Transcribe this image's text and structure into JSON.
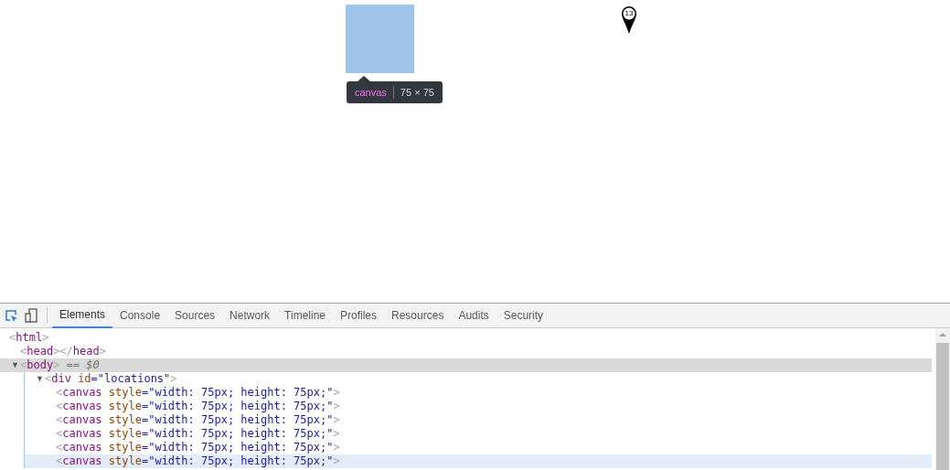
{
  "page": {
    "marker_label": "13",
    "tooltip": {
      "tag": "canvas",
      "size": "75 × 75"
    }
  },
  "devtools": {
    "tabs": [
      {
        "label": "Elements",
        "selected": true
      },
      {
        "label": "Console",
        "selected": false
      },
      {
        "label": "Sources",
        "selected": false
      },
      {
        "label": "Network",
        "selected": false
      },
      {
        "label": "Timeline",
        "selected": false
      },
      {
        "label": "Profiles",
        "selected": false
      },
      {
        "label": "Resources",
        "selected": false
      },
      {
        "label": "Audits",
        "selected": false
      },
      {
        "label": "Security",
        "selected": false
      }
    ],
    "dom_tree": [
      {
        "selected": false,
        "hovered": false,
        "parts": [
          {
            "kind": "punct",
            "text": "<"
          },
          {
            "kind": "tag",
            "text": "html"
          },
          {
            "kind": "punct",
            "text": ">"
          }
        ],
        "children": [
          {
            "selected": false,
            "hovered": false,
            "parts": [
              {
                "kind": "punct",
                "text": "<"
              },
              {
                "kind": "tag",
                "text": "head"
              },
              {
                "kind": "punct",
                "text": "></"
              },
              {
                "kind": "tag",
                "text": "head"
              },
              {
                "kind": "punct",
                "text": ">"
              }
            ]
          },
          {
            "arrow": "▼",
            "selected": true,
            "hovered": false,
            "parts": [
              {
                "kind": "punct",
                "text": "<"
              },
              {
                "kind": "tag",
                "text": "body"
              },
              {
                "kind": "punct",
                "text": ">"
              },
              {
                "kind": "note",
                "text": " == $0"
              }
            ],
            "children": [
              {
                "arrow": "▼",
                "selected": false,
                "hovered": false,
                "parts": [
                  {
                    "kind": "punct",
                    "text": "<"
                  },
                  {
                    "kind": "tag",
                    "text": "div"
                  },
                  {
                    "kind": "attr",
                    "text": " id"
                  },
                  {
                    "kind": "plain",
                    "text": "=\""
                  },
                  {
                    "kind": "value",
                    "text": "locations"
                  },
                  {
                    "kind": "plain",
                    "text": "\""
                  },
                  {
                    "kind": "punct",
                    "text": ">"
                  }
                ],
                "children": [
                  {
                    "selected": false,
                    "hovered": false,
                    "parts": [
                      {
                        "kind": "punct",
                        "text": "<"
                      },
                      {
                        "kind": "tag",
                        "text": "canvas"
                      },
                      {
                        "kind": "attr",
                        "text": " style"
                      },
                      {
                        "kind": "plain",
                        "text": "=\""
                      },
                      {
                        "kind": "value",
                        "text": "width: 75px; height: 75px;"
                      },
                      {
                        "kind": "plain",
                        "text": "\""
                      },
                      {
                        "kind": "punct",
                        "text": ">"
                      }
                    ]
                  },
                  {
                    "selected": false,
                    "hovered": false,
                    "parts": [
                      {
                        "kind": "punct",
                        "text": "<"
                      },
                      {
                        "kind": "tag",
                        "text": "canvas"
                      },
                      {
                        "kind": "attr",
                        "text": " style"
                      },
                      {
                        "kind": "plain",
                        "text": "=\""
                      },
                      {
                        "kind": "value",
                        "text": "width: 75px; height: 75px;"
                      },
                      {
                        "kind": "plain",
                        "text": "\""
                      },
                      {
                        "kind": "punct",
                        "text": ">"
                      }
                    ]
                  },
                  {
                    "selected": false,
                    "hovered": false,
                    "parts": [
                      {
                        "kind": "punct",
                        "text": "<"
                      },
                      {
                        "kind": "tag",
                        "text": "canvas"
                      },
                      {
                        "kind": "attr",
                        "text": " style"
                      },
                      {
                        "kind": "plain",
                        "text": "=\""
                      },
                      {
                        "kind": "value",
                        "text": "width: 75px; height: 75px;"
                      },
                      {
                        "kind": "plain",
                        "text": "\""
                      },
                      {
                        "kind": "punct",
                        "text": ">"
                      }
                    ]
                  },
                  {
                    "selected": false,
                    "hovered": false,
                    "parts": [
                      {
                        "kind": "punct",
                        "text": "<"
                      },
                      {
                        "kind": "tag",
                        "text": "canvas"
                      },
                      {
                        "kind": "attr",
                        "text": " style"
                      },
                      {
                        "kind": "plain",
                        "text": "=\""
                      },
                      {
                        "kind": "value",
                        "text": "width: 75px; height: 75px;"
                      },
                      {
                        "kind": "plain",
                        "text": "\""
                      },
                      {
                        "kind": "punct",
                        "text": ">"
                      }
                    ]
                  },
                  {
                    "selected": false,
                    "hovered": false,
                    "parts": [
                      {
                        "kind": "punct",
                        "text": "<"
                      },
                      {
                        "kind": "tag",
                        "text": "canvas"
                      },
                      {
                        "kind": "attr",
                        "text": " style"
                      },
                      {
                        "kind": "plain",
                        "text": "=\""
                      },
                      {
                        "kind": "value",
                        "text": "width: 75px; height: 75px;"
                      },
                      {
                        "kind": "plain",
                        "text": "\""
                      },
                      {
                        "kind": "punct",
                        "text": ">"
                      }
                    ]
                  },
                  {
                    "selected": false,
                    "hovered": true,
                    "parts": [
                      {
                        "kind": "punct",
                        "text": "<"
                      },
                      {
                        "kind": "tag",
                        "text": "canvas"
                      },
                      {
                        "kind": "attr",
                        "text": " style"
                      },
                      {
                        "kind": "plain",
                        "text": "=\""
                      },
                      {
                        "kind": "value",
                        "text": "width: 75px; height: 75px;"
                      },
                      {
                        "kind": "plain",
                        "text": "\""
                      },
                      {
                        "kind": "punct",
                        "text": ">"
                      }
                    ]
                  }
                ]
              }
            ]
          }
        ]
      }
    ]
  }
}
